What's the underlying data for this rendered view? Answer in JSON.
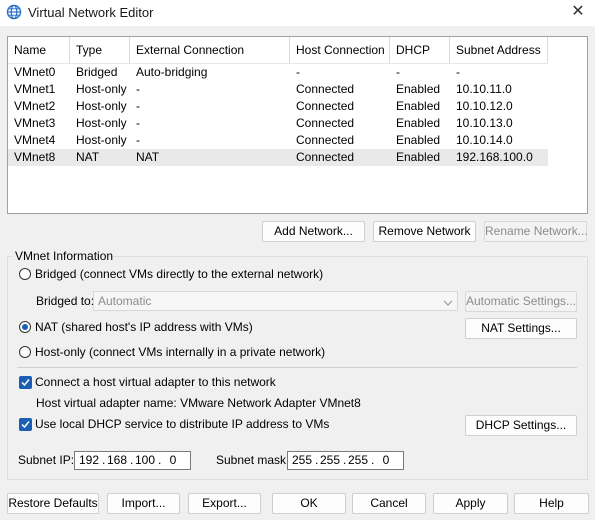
{
  "window": {
    "title": "Virtual Network Editor",
    "icon": "globe-icon",
    "close_icon": "close-icon",
    "close_glyph": "✕"
  },
  "table": {
    "columns": [
      "Name",
      "Type",
      "External Connection",
      "Host Connection",
      "DHCP",
      "Subnet Address"
    ],
    "rows": [
      [
        "VMnet0",
        "Bridged",
        "Auto-bridging",
        "-",
        "-",
        "-"
      ],
      [
        "VMnet1",
        "Host-only",
        "-",
        "Connected",
        "Enabled",
        "10.10.11.0"
      ],
      [
        "VMnet2",
        "Host-only",
        "-",
        "Connected",
        "Enabled",
        "10.10.12.0"
      ],
      [
        "VMnet3",
        "Host-only",
        "-",
        "Connected",
        "Enabled",
        "10.10.13.0"
      ],
      [
        "VMnet4",
        "Host-only",
        "-",
        "Connected",
        "Enabled",
        "10.10.14.0"
      ],
      [
        "VMnet8",
        "NAT",
        "NAT",
        "Connected",
        "Enabled",
        "192.168.100.0"
      ]
    ],
    "selected_row": 5
  },
  "network_buttons": {
    "add": "Add Network...",
    "remove": "Remove Network",
    "rename": "Rename Network..."
  },
  "vmnet_info": {
    "label": "VMnet Information",
    "bridged_radio": "Bridged (connect VMs directly to the external network)",
    "bridged_to_label": "Bridged to:",
    "bridged_to_value": "Automatic",
    "automatic_settings": "Automatic Settings...",
    "nat_radio": "NAT (shared host's IP address with VMs)",
    "nat_settings": "NAT Settings...",
    "hostonly_radio": "Host-only (connect VMs internally in a private network)",
    "selected_mode": "nat",
    "connect_adapter_check": "Connect a host virtual adapter to this network",
    "adapter_name_label": "Host virtual adapter name: VMware Network Adapter VMnet8",
    "dhcp_check": "Use local DHCP service to distribute IP address to VMs",
    "dhcp_settings": "DHCP Settings...",
    "subnet_ip_label": "Subnet IP:",
    "subnet_ip": [
      "192",
      "168",
      "100",
      "0"
    ],
    "subnet_mask_label": "Subnet mask:",
    "subnet_mask": [
      "255",
      "255",
      "255",
      "0"
    ]
  },
  "footer_buttons": {
    "restore": "Restore Defaults",
    "import": "Import...",
    "export": "Export...",
    "ok": "OK",
    "cancel": "Cancel",
    "apply": "Apply",
    "help": "Help"
  },
  "colors": {
    "accent": "#1a5fb4",
    "selected_row": "#e9e9e9",
    "background": "#f0f0f0"
  }
}
